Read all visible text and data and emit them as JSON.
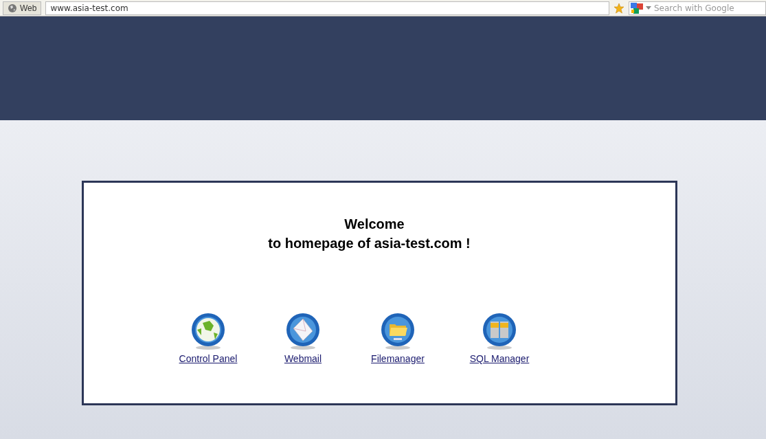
{
  "toolbar": {
    "site_label": "Web",
    "address": "www.asia-test.com",
    "search_placeholder": "Search with Google"
  },
  "welcome": {
    "title": "Welcome",
    "subtitle": "to homepage of asia-test.com !"
  },
  "links": [
    {
      "kind": "globe",
      "label": "Control Panel"
    },
    {
      "kind": "mail",
      "label": "Webmail"
    },
    {
      "kind": "folder",
      "label": "Filemanager"
    },
    {
      "kind": "database",
      "label": "SQL Manager"
    }
  ]
}
